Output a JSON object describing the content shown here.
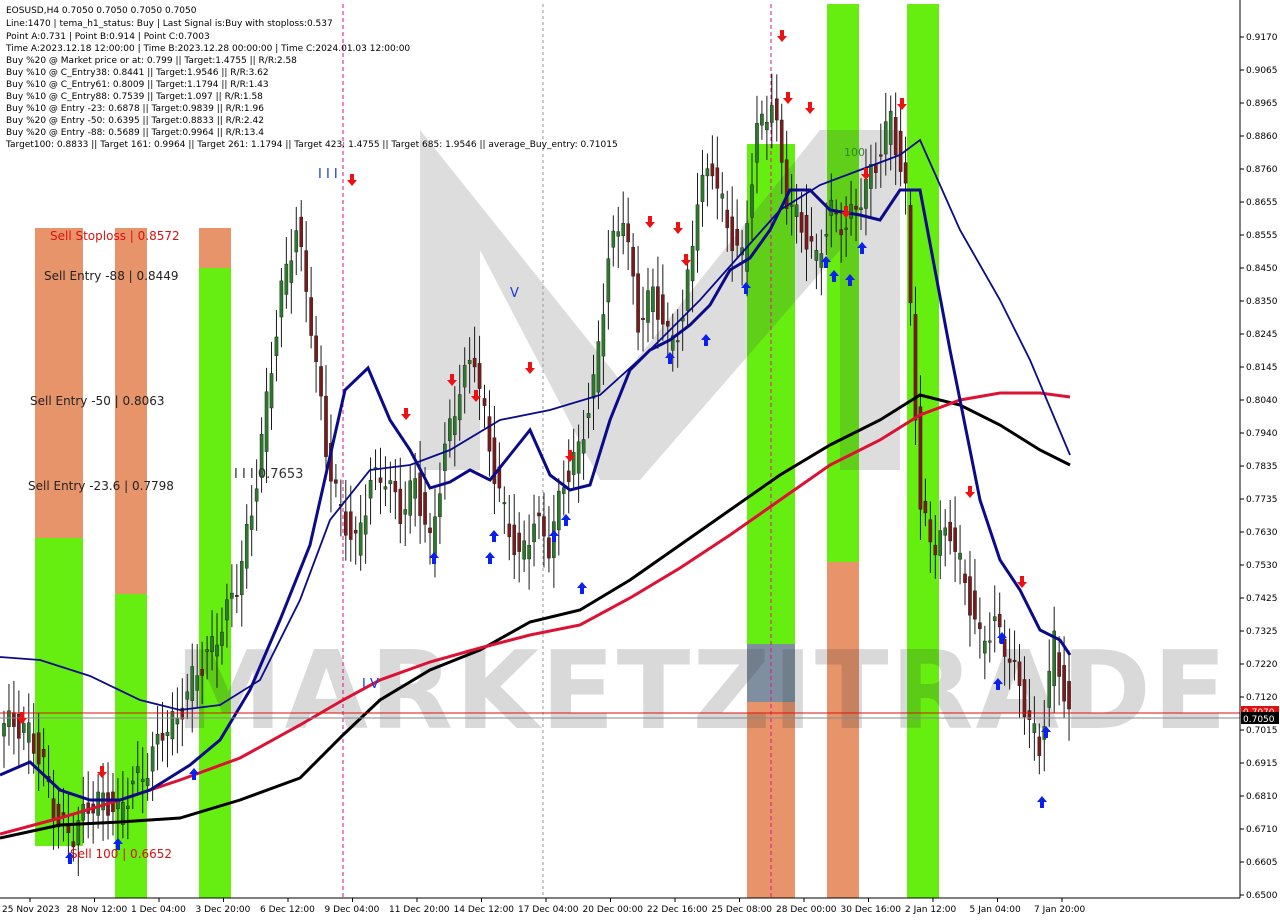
{
  "header": {
    "symbol_line": "EOSUSD,H4  0.7050 0.7050 0.7050 0.7050",
    "info_lines": [
      "Line:1470  | tema_h1_status: Buy  | Last Signal is:Buy with stoploss:0.537",
      "Point A:0.731  | Point B:0.914  | Point C:0.7003",
      "Time A:2023.12.18 12:00:00  | Time B:2023.12.28 00:00:00  | Time C:2024.01.03 12:00:00",
      "Buy %20 @ Market price or at: 0.799  || Target:1.4755  || R/R:2.58",
      "Buy %10 @ C_Entry38: 0.8441  || Target:1.9546  || R/R:3.62",
      "Buy %10 @ C_Entry61: 0.8009  || Target:1.1794  || R/R:1.43",
      "Buy %10 @ C_Entry88: 0.7539  || Target:1.097  || R/R:1.58",
      "Buy %10 @ Entry -23: 0.6878  || Target:0.9839  || R/R:1.96",
      "Buy %20 @ Entry -50: 0.6395  || Target:0.8833  || R/R:2.42",
      "Buy %20 @ Entry -88: 0.5689  || Target:0.9964  || R/R:13.4",
      "Target100: 0.8833  || Target 161: 0.9964  || Target 261: 1.1794  || Target 423: 1.4755  || Target 685: 1.9546  || average_Buy_entry: 0.71015"
    ]
  },
  "zone_labels": {
    "sell_stoploss": "Sell Stoploss | 0.8572",
    "sell_entry_88": "Sell Entry -88 | 0.8449",
    "sell_entry_50": "Sell Entry -50 | 0.8063",
    "sell_entry_23": "Sell Entry -23.6 | 0.7798",
    "sell_100": "Sell 100 | 0.6652"
  },
  "wave_labels": {
    "w3": "I I I",
    "w3_price": "I I I 0.7653",
    "w4": "I V",
    "w5": "V",
    "w100": "100"
  },
  "price_axis": {
    "ticks": [
      "0.9170",
      "0.9065",
      "0.8965",
      "0.8860",
      "0.8760",
      "0.8655",
      "0.8555",
      "0.8450",
      "0.8350",
      "0.8245",
      "0.8145",
      "0.8040",
      "0.7940",
      "0.7835",
      "0.7735",
      "0.7630",
      "0.7530",
      "0.7425",
      "0.7325",
      "0.7220",
      "0.7120",
      "0.7015",
      "0.6915",
      "0.6810",
      "0.6710",
      "0.6605",
      "0.6500"
    ],
    "current_price": "0.7050",
    "red_line_price": "0.7070"
  },
  "time_axis": {
    "labels": [
      "25 Nov 2023",
      "28 Nov 12:00",
      "1 Dec 04:00",
      "3 Dec 20:00",
      "6 Dec 12:00",
      "9 Dec 04:00",
      "11 Dec 20:00",
      "14 Dec 12:00",
      "17 Dec 04:00",
      "20 Dec 00:00",
      "22 Dec 16:00",
      "25 Dec 08:00",
      "28 Dec 00:00",
      "30 Dec 16:00",
      "2 Jan 12:00",
      "5 Jan 04:00",
      "7 Jan 20:00"
    ]
  },
  "watermark": "MARKETZITRADE",
  "colors": {
    "green_zone": "#66ee11",
    "orange_zone": "#e8946a",
    "sell_text": "#dd1111",
    "buy_arrow": "#0a20ee",
    "sell_arrow": "#ee1111",
    "ema_red": "#dd1133",
    "ema_black": "#000000",
    "ema_navy": "#0a0a8a"
  },
  "chart_data": {
    "type": "candlestick",
    "symbol": "EOSUSD",
    "timeframe": "H4",
    "ylim": [
      0.65,
      0.92
    ],
    "last_price": 0.705,
    "x_labels": [
      "25 Nov 2023",
      "28 Nov 12:00",
      "1 Dec 04:00",
      "3 Dec 20:00",
      "6 Dec 12:00",
      "9 Dec 04:00",
      "11 Dec 20:00",
      "14 Dec 12:00",
      "17 Dec 04:00",
      "20 Dec 00:00",
      "22 Dec 16:00",
      "25 Dec 08:00",
      "28 Dec 00:00",
      "30 Dec 16:00",
      "2 Jan 12:00",
      "5 Jan 04:00",
      "7 Jan 20:00"
    ],
    "series": [
      {
        "values": [
          0.704,
          0.701,
          0.69,
          0.672,
          0.669,
          0.678,
          0.68,
          0.676,
          0.685,
          0.69,
          0.702,
          0.705,
          0.718,
          0.725,
          0.735,
          0.748,
          0.77,
          0.805,
          0.84,
          0.86,
          0.83,
          0.79,
          0.77,
          0.76,
          0.78,
          0.782,
          0.77,
          0.78,
          0.76,
          0.79,
          0.81,
          0.82,
          0.79,
          0.77,
          0.755,
          0.768,
          0.76,
          0.78,
          0.79,
          0.81,
          0.85,
          0.865,
          0.83,
          0.84,
          0.825,
          0.83,
          0.87,
          0.88,
          0.86,
          0.85,
          0.89,
          0.9,
          0.87,
          0.86,
          0.85,
          0.865,
          0.86,
          0.87,
          0.88,
          0.895,
          0.87,
          0.77,
          0.76,
          0.765,
          0.748,
          0.73,
          0.735,
          0.725,
          0.71,
          0.695,
          0.73,
          0.705
        ]
      }
    ],
    "overlays": [
      {
        "name": "ema_red",
        "values": [
          0.67,
          0.675,
          0.68,
          0.687,
          0.695,
          0.705,
          0.715,
          0.723,
          0.73,
          0.737,
          0.745,
          0.756,
          0.769,
          0.782,
          0.793,
          0.802,
          0.805,
          0.804
        ]
      },
      {
        "name": "ema_black",
        "values": [
          0.67,
          0.672,
          0.675,
          0.679,
          0.687,
          0.697,
          0.71,
          0.727,
          0.735,
          0.74,
          0.753,
          0.765,
          0.778,
          0.787,
          0.796,
          0.805,
          0.795,
          0.785
        ]
      }
    ]
  }
}
